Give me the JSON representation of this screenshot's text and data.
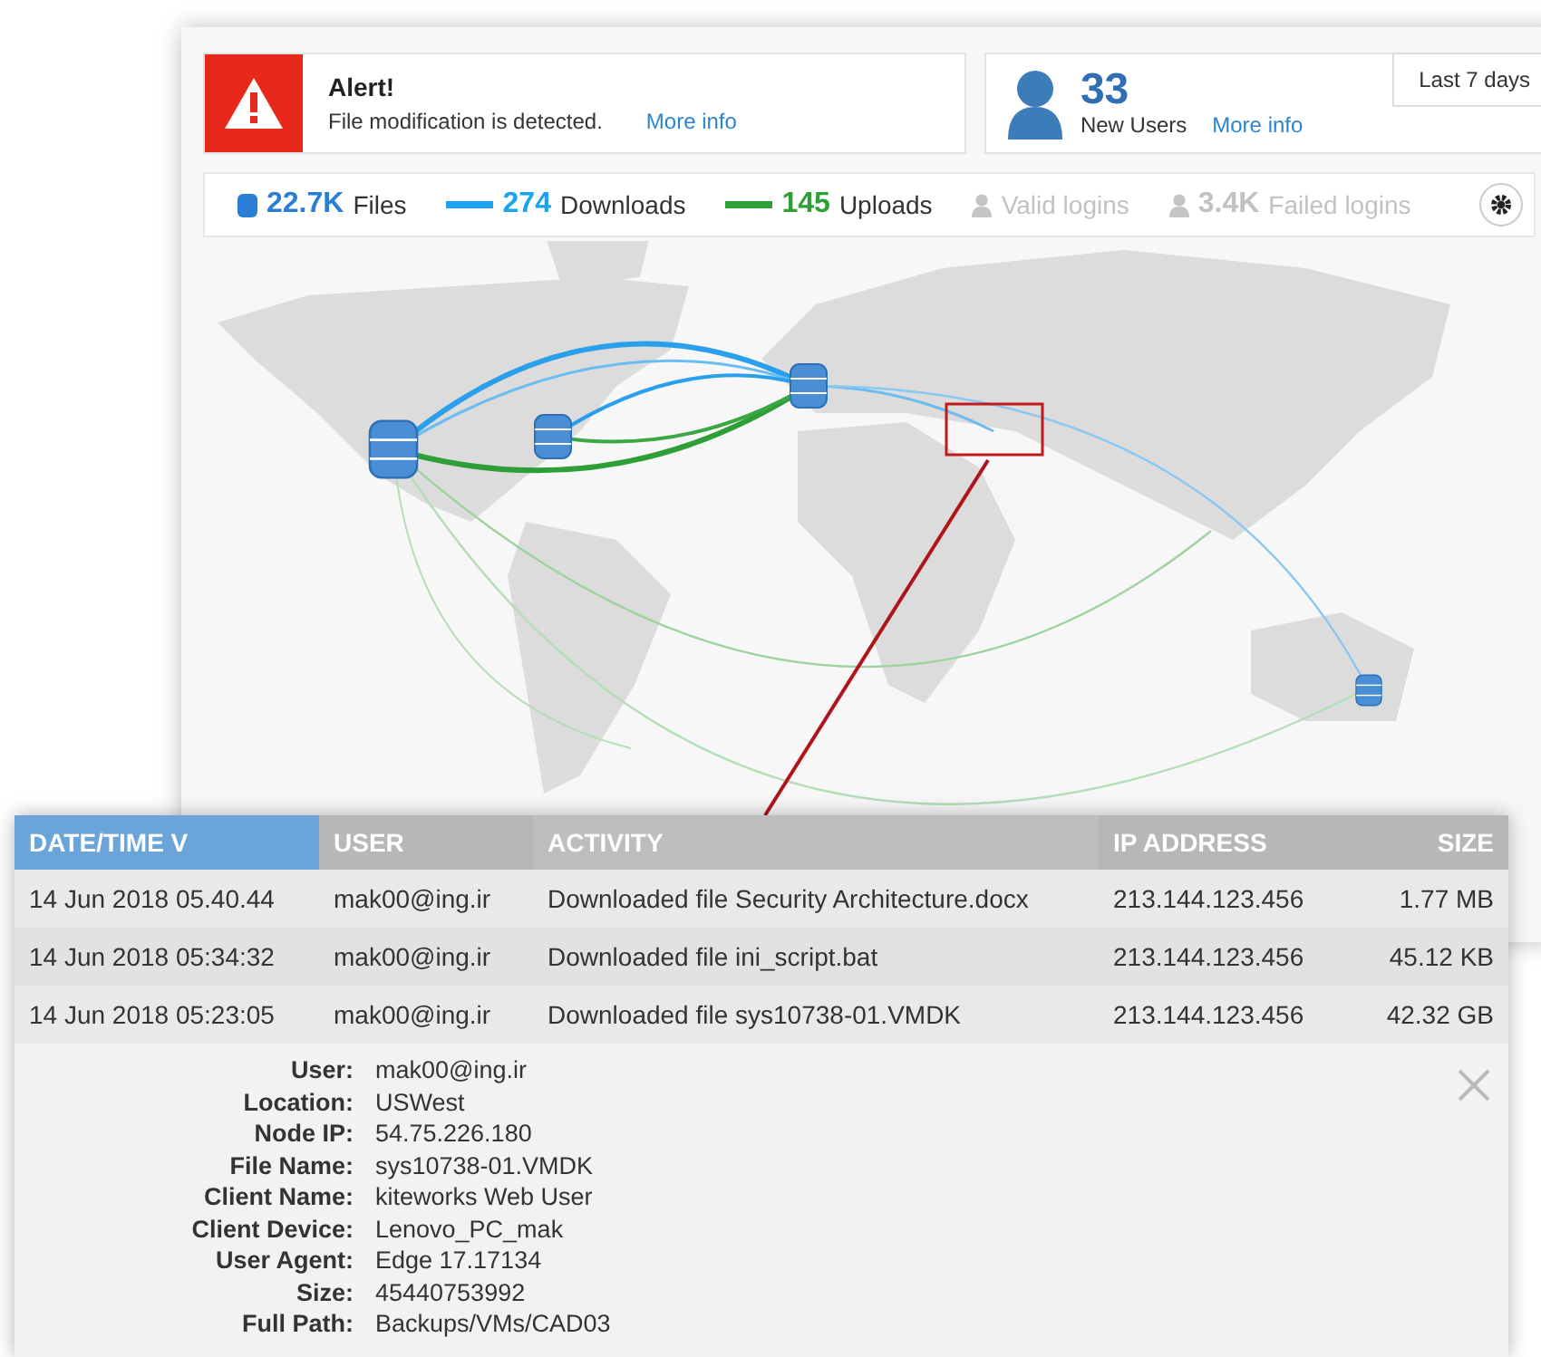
{
  "alert": {
    "title": "Alert!",
    "message": "File modification is detected.",
    "link": "More info"
  },
  "users": {
    "count": "33",
    "label": "New Users",
    "link": "More info"
  },
  "date_range": "Last 7 days",
  "stats": [
    {
      "kind": "files",
      "value": "22.7K",
      "label": "Files",
      "color": "#2a7fd4",
      "disabled": false
    },
    {
      "kind": "line",
      "value": "274",
      "label": "Downloads",
      "color": "#1aa3f0",
      "disabled": false
    },
    {
      "kind": "line",
      "value": "145",
      "label": "Uploads",
      "color": "#2e9e36",
      "disabled": false
    },
    {
      "kind": "person",
      "label": "Valid logins",
      "disabled": true
    },
    {
      "kind": "person",
      "value": "3.4K",
      "label": "Failed logins",
      "disabled": true
    }
  ],
  "table": {
    "columns": [
      {
        "label": "DATE/TIME V",
        "selected": true
      },
      {
        "label": "USER",
        "selected": false
      },
      {
        "label": "ACTIVITY",
        "selected": false
      },
      {
        "label": "IP ADDRESS",
        "selected": false
      },
      {
        "label": "SIZE",
        "selected": false
      }
    ],
    "rows": [
      [
        "14 Jun 2018 05.40.44",
        "mak00@ing.ir",
        "Downloaded file Security Architecture.docx",
        "213.144.123.456",
        "1.77 MB"
      ],
      [
        "14 Jun 2018 05:34:32",
        "mak00@ing.ir",
        "Downloaded file ini_script.bat",
        "213.144.123.456",
        "45.12 KB"
      ],
      [
        "14 Jun 2018 05:23:05",
        "mak00@ing.ir",
        "Downloaded file sys10738-01.VMDK",
        "213.144.123.456",
        "42.32 GB"
      ]
    ]
  },
  "details": [
    {
      "label": "User:",
      "value": "mak00@ing.ir"
    },
    {
      "label": "Location:",
      "value": "USWest"
    },
    {
      "label": "Node IP:",
      "value": "54.75.226.180"
    },
    {
      "label": "File Name:",
      "value": "sys10738-01.VMDK"
    },
    {
      "label": "Client Name:",
      "value": "kiteworks Web User"
    },
    {
      "label": "Client Device:",
      "value": "Lenovo_PC_mak"
    },
    {
      "label": "User Agent:",
      "value": "Edge 17.17134"
    },
    {
      "label": "Size:",
      "value": "45440753992"
    },
    {
      "label": "Full Path:",
      "value": "Backups/VMs/CAD03"
    }
  ]
}
